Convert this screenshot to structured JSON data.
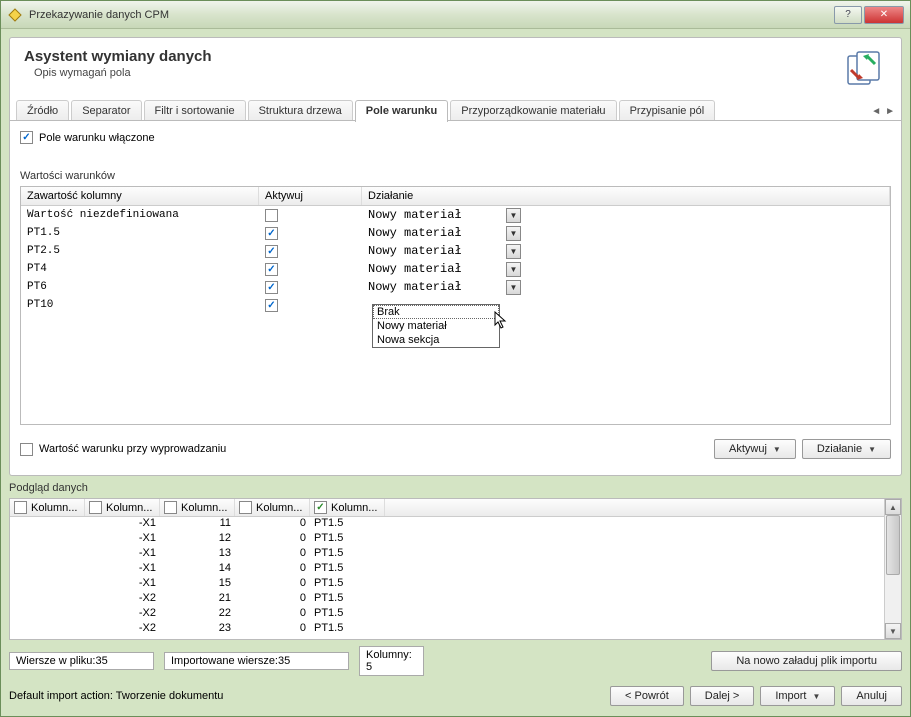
{
  "window": {
    "title": "Przekazywanie danych CPM"
  },
  "header": {
    "title": "Asystent wymiany danych",
    "subtitle": "Opis wymagań pola"
  },
  "tabs": [
    "Źródło",
    "Separator",
    "Filtr i sortowanie",
    "Struktura drzewa",
    "Pole warunku",
    "Przyporządkowanie materiału",
    "Przypisanie pól"
  ],
  "condition": {
    "enabled_label": "Pole warunku włączone",
    "values_label": "Wartości warunków",
    "columns": {
      "content": "Zawartość kolumny",
      "activate": "Aktywuj",
      "action": "Działanie"
    },
    "rows": [
      {
        "content": "Wartość niezdefiniowana",
        "activate": false,
        "action": "Nowy materiał"
      },
      {
        "content": "PT1.5",
        "activate": true,
        "action": "Nowy materiał"
      },
      {
        "content": "PT2.5",
        "activate": true,
        "action": "Nowy materiał"
      },
      {
        "content": "PT4",
        "activate": true,
        "action": "Nowy materiał"
      },
      {
        "content": "PT6",
        "activate": true,
        "action": "Nowy materiał"
      },
      {
        "content": "PT10",
        "activate": true,
        "action": ""
      }
    ],
    "dropdown": [
      "Brak",
      "Nowy materiał",
      "Nowa sekcja"
    ],
    "derive_label": "Wartość warunku przy wyprowadzaniu"
  },
  "buttons": {
    "activate": "Aktywuj",
    "action": "Działanie",
    "reload": "Na nowo załaduj plik importu",
    "back": "<  Powrót",
    "next": "Dalej  >",
    "import": "Import",
    "cancel": "Anuluj"
  },
  "preview": {
    "label": "Podgląd danych",
    "col_label": "Kolumn...",
    "rows": [
      [
        "",
        "-X1",
        "11",
        "0",
        "PT1.5"
      ],
      [
        "",
        "-X1",
        "12",
        "0",
        "PT1.5"
      ],
      [
        "",
        "-X1",
        "13",
        "0",
        "PT1.5"
      ],
      [
        "",
        "-X1",
        "14",
        "0",
        "PT1.5"
      ],
      [
        "",
        "-X1",
        "15",
        "0",
        "PT1.5"
      ],
      [
        "",
        "-X2",
        "21",
        "0",
        "PT1.5"
      ],
      [
        "",
        "-X2",
        "22",
        "0",
        "PT1.5"
      ],
      [
        "",
        "-X2",
        "23",
        "0",
        "PT1.5"
      ]
    ],
    "status": {
      "rows_in_file": "Wiersze w pliku:35",
      "imported_rows": "Importowane wiersze:35",
      "columns": "Kolumny: 5"
    }
  },
  "footer": {
    "default_action": "Default import action: Tworzenie dokumentu"
  }
}
